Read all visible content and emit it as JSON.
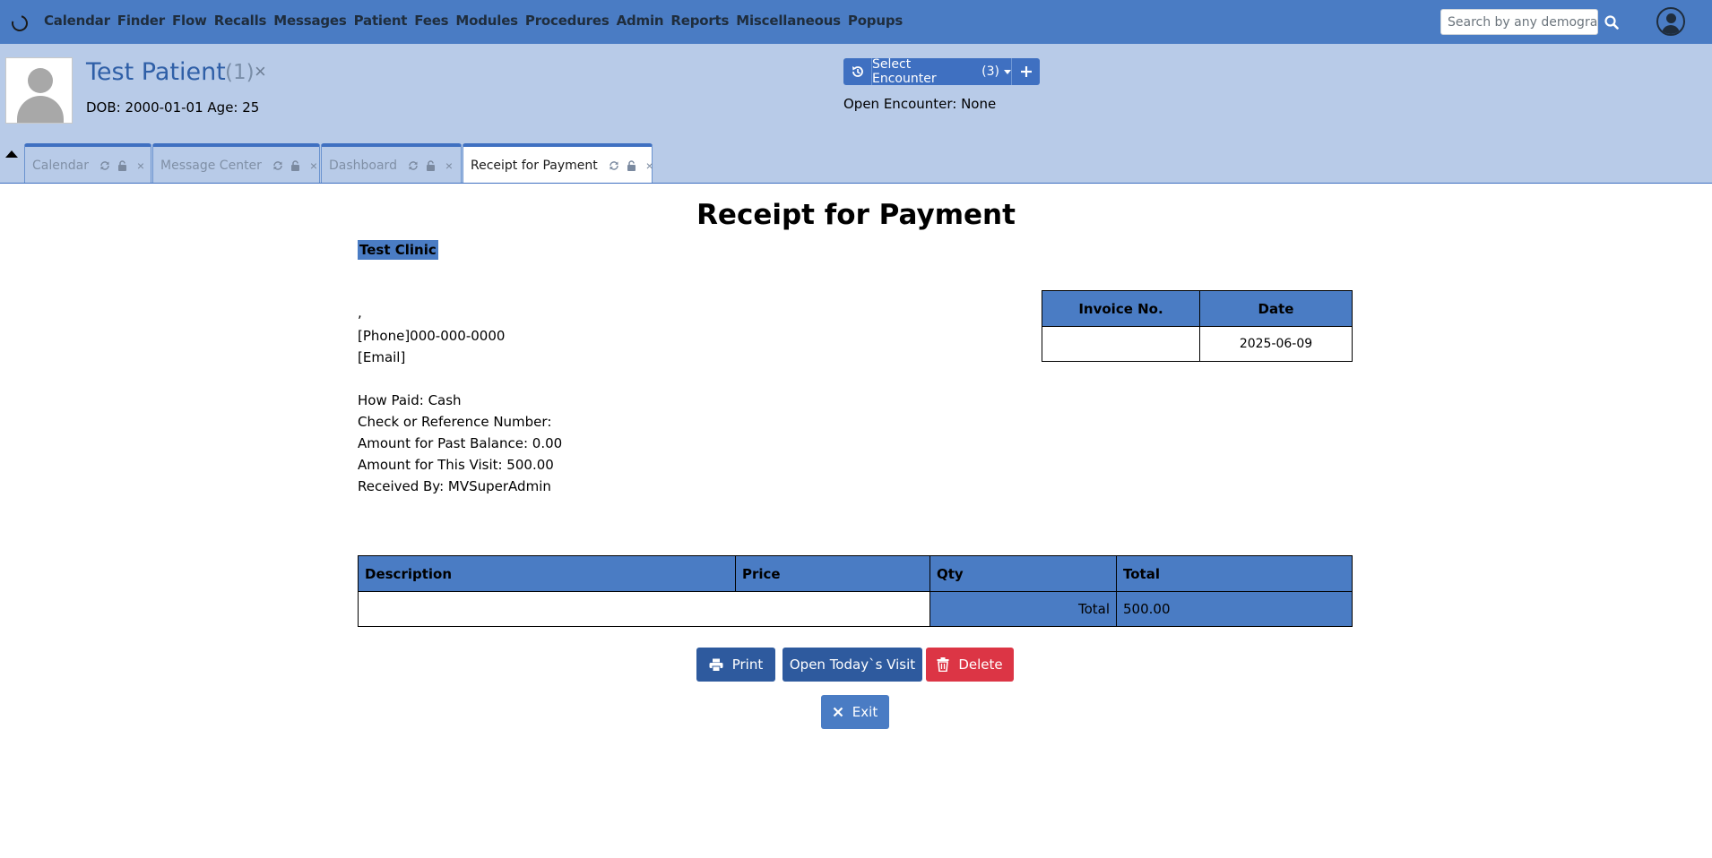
{
  "navbar": {
    "menu": [
      "Calendar",
      "Finder",
      "Flow",
      "Recalls",
      "Messages",
      "Patient",
      "Fees",
      "Modules",
      "Procedures",
      "Admin",
      "Reports",
      "Miscellaneous",
      "Popups"
    ],
    "search_placeholder": "Search by any demographics"
  },
  "patient": {
    "name": "Test Patient",
    "pid": "(1)",
    "dob_line": "DOB: 2000-01-01 Age: 25"
  },
  "encounter": {
    "select_label": "Select Encounter",
    "count": "(3)",
    "open_encounter": "Open Encounter: None"
  },
  "tabs": [
    {
      "label": "Calendar"
    },
    {
      "label": "Message Center"
    },
    {
      "label": "Dashboard"
    },
    {
      "label": "Receipt for Payment"
    }
  ],
  "receipt": {
    "title": "Receipt for Payment",
    "clinic_name": "Test Clinic",
    "address_line": ",",
    "phone_line": "[Phone]000-000-0000",
    "email_line": "[Email]",
    "how_paid": "How Paid: Cash",
    "check_ref": "Check or Reference Number:",
    "past_balance": "Amount for Past Balance: 0.00",
    "this_visit": "Amount for This Visit: 500.00",
    "received_by": "Received By: MVSuperAdmin",
    "invoice_table": {
      "headers": [
        "Invoice No.",
        "Date"
      ],
      "invoice_no": "",
      "date": "2025-06-09"
    },
    "items_table": {
      "headers": [
        "Description",
        "Price",
        "Qty",
        "Total"
      ],
      "total_label": "Total",
      "total_value": "500.00"
    }
  },
  "buttons": {
    "print": "Print",
    "open_visit": "Open Today`s Visit",
    "delete": "Delete",
    "exit": "Exit"
  },
  "colors": {
    "navbar": "#4a7cc4",
    "header": "#b8cbe8",
    "primary": "#2e5a9e",
    "danger": "#dc3545"
  }
}
